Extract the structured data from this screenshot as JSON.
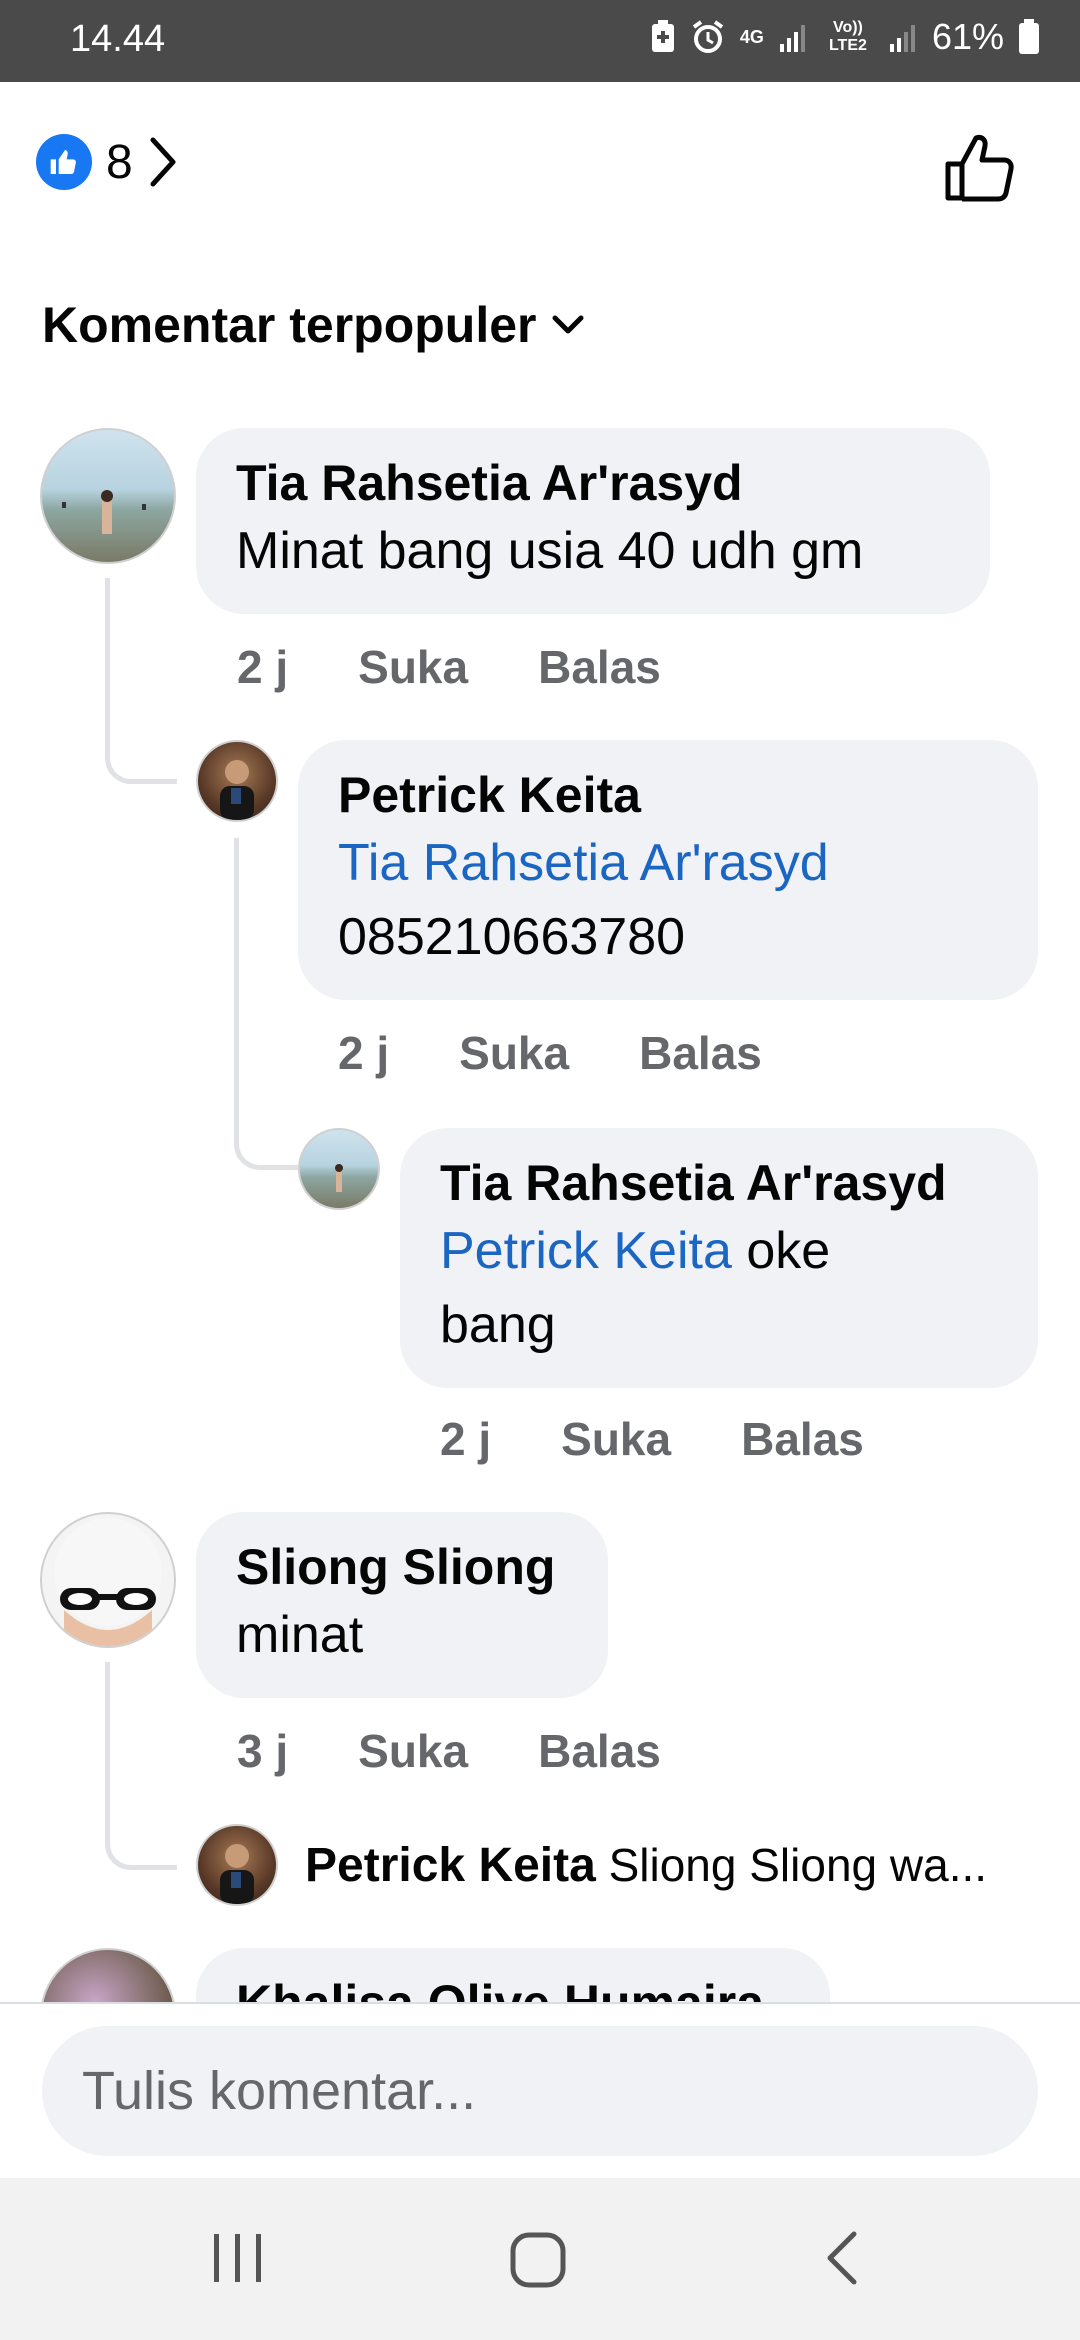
{
  "status_bar": {
    "time": "14.44",
    "network": "4G",
    "sim2": "Vo)) LTE2",
    "battery": "61%"
  },
  "reactions": {
    "count": "8"
  },
  "sort": {
    "label": "Komentar terpopuler"
  },
  "comments": [
    {
      "name": "Tia Rahsetia Ar'rasyd",
      "text": "Minat bang usia 40 udh gm",
      "time": "2 j",
      "like": "Suka",
      "reply": "Balas"
    },
    {
      "name": "Petrick Keita",
      "mention": "Tia Rahsetia Ar'rasyd",
      "text": "085210663780",
      "time": "2 j",
      "like": "Suka",
      "reply": "Balas"
    },
    {
      "name": "Tia Rahsetia Ar'rasyd",
      "mention": "Petrick Keita",
      "text_line1": "oke",
      "text_line2": "bang",
      "time": "2 j",
      "like": "Suka",
      "reply": "Balas"
    },
    {
      "name": "Sliong Sliong",
      "text": "minat",
      "time": "3 j",
      "like": "Suka",
      "reply": "Balas"
    },
    {
      "name": "Petrick Keita",
      "text": "Sliong Sliong wa..."
    },
    {
      "name": "Khalisa Olive Humaira"
    }
  ],
  "composer": {
    "placeholder": "Tulis komentar..."
  },
  "icons": {
    "like_badge": "thumbs-up-filled",
    "like_button": "thumbs-up-outline",
    "chevron": "chevron-right",
    "dropdown": "chevron-down",
    "nav_recent": "recent-apps",
    "nav_home": "home",
    "nav_back": "back"
  },
  "colors": {
    "accent": "#1877f2",
    "mention": "#1a66c2",
    "bubble": "#f0f2f5",
    "meta": "#65676b"
  }
}
